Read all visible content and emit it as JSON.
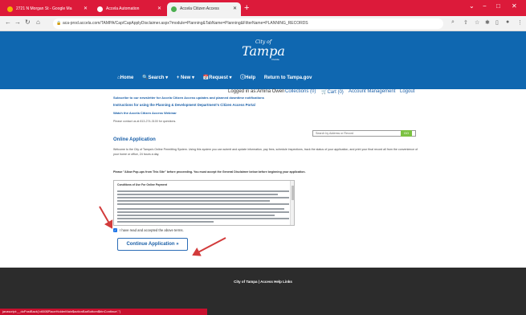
{
  "browser": {
    "tabs": [
      {
        "label": "2721 N Morgan St - Google Ma",
        "icon": "maps-pin-icon",
        "color": "#f4b400"
      },
      {
        "label": "Accela Automation",
        "icon": "accela-icon",
        "color": "#ffffff"
      },
      {
        "label": "Accela Citizen Access",
        "icon": "accela-icon",
        "color": "#4caf50"
      }
    ],
    "new_tab": "+",
    "url": "aca-prod.accela.com/TAMPA/Cap/CapApplyDisclaimer.aspx?module=Planning&TabName=Planning&FilterName=PLANNING_RECORDS",
    "window_controls": [
      "⌄",
      "−",
      "□",
      "✕"
    ]
  },
  "header": {
    "logo_city_of": "City of",
    "logo_tampa": "Tampa",
    "logo_florida": "Florida",
    "nav": [
      "⌂Home",
      "🔍Search ▾",
      "+ New ▾",
      "📅Request ▾",
      "ⓘHelp",
      "Return to Tampa.gov"
    ]
  },
  "account": {
    "logged_in": "Logged in as:Amina Owen",
    "collections": "Collections (0)",
    "cart": "🛒Cart (0)",
    "account_mgmt": "Account Management",
    "logout": "Logout"
  },
  "content": {
    "links": [
      "Subscribe to our newsletter for Accela Citizen Access updates and planned downtime notifications",
      "Instructions for using the Planning & Development Department's Citizen Access Portal",
      "Watch the Accela Citizen Access Webinar"
    ],
    "contact": "Please contact us at 813-274-3100 for questions.",
    "search_placeholder": "Search by Address or Record",
    "search_go": "GO",
    "heading": "Online Application",
    "welcome": "Welcome to the City of Tampa's Online Permitting System. Using this system you can submit and update information, pay fees, schedule inspections, track the status of your application, and print your final record all from the convenience of your home or office, 24 hours a day.",
    "popups": "Please \"Allow Pop-ups from This Site\" before proceeding. You must accept the General Disclaimer below before beginning your application.",
    "disclaimer_title": "Conditions of Use For Online Payment",
    "checkbox_label": "I have read and accepted the above terms.",
    "continue_button": "Continue Application »"
  },
  "footer": {
    "links": "City of Tampa | Access Help Links"
  },
  "status_url": "javascript:__doPostBack('ctl00$PlaceHolderMain$actionBarBottom$btnContinue','')"
}
